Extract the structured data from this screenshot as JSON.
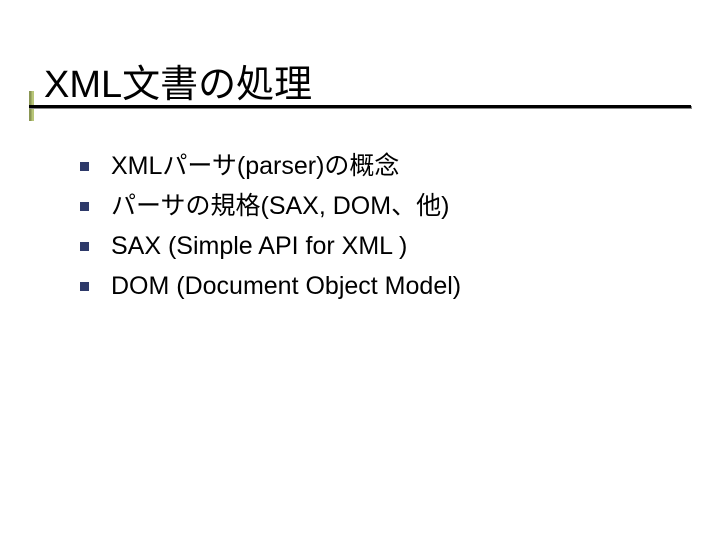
{
  "slide": {
    "title": "XML文書の処理",
    "bullets": [
      "XMLパーサ(parser)の概念",
      "パーサの規格(SAX, DOM、他)",
      "SAX (Simple API for XML )",
      "DOM (Document Object Model)"
    ]
  }
}
